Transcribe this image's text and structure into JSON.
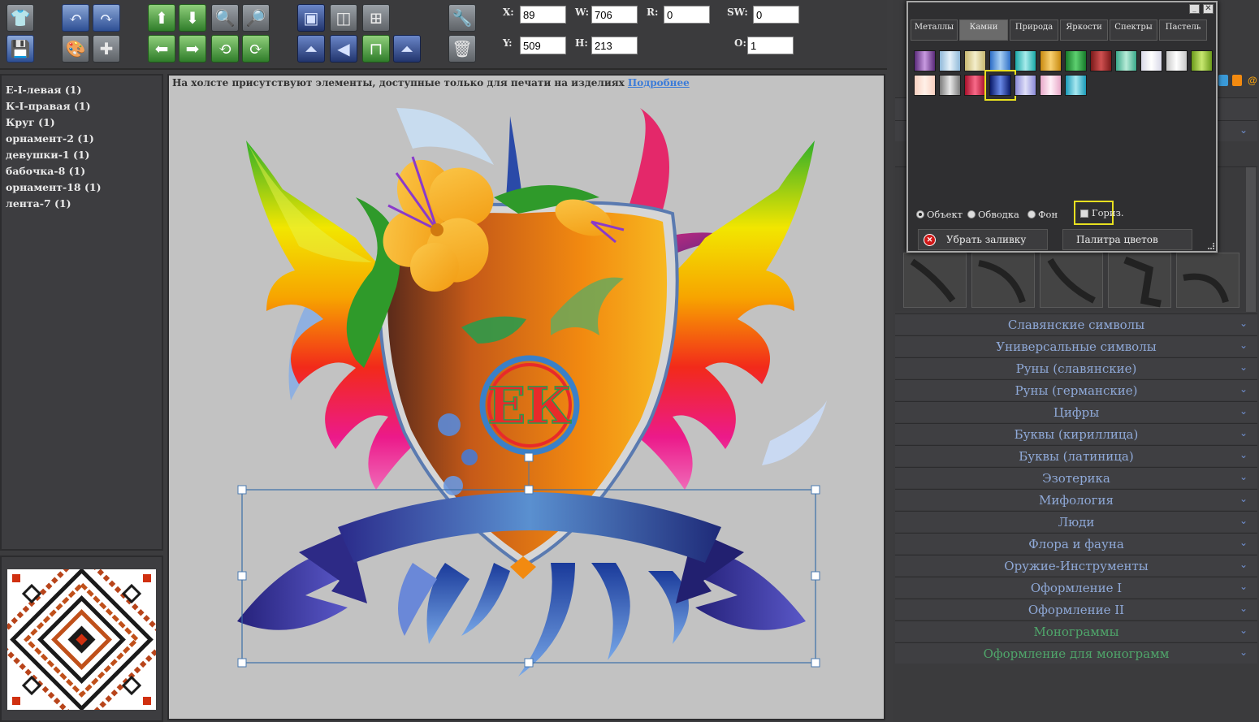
{
  "toolbar": {
    "buttons": [
      {
        "name": "tshirt-icon",
        "glyph": "👕"
      },
      {
        "name": "save-disk-icon",
        "glyph": "💾"
      },
      {
        "name": "undo-icon",
        "glyph": "↶"
      },
      {
        "name": "redo-icon",
        "glyph": "↷"
      },
      {
        "name": "palette-icon",
        "glyph": "🎨"
      },
      {
        "name": "add-element-icon",
        "glyph": "✚"
      },
      {
        "name": "move-up-icon",
        "glyph": "⬆"
      },
      {
        "name": "move-down-icon",
        "glyph": "⬇"
      },
      {
        "name": "move-left-icon",
        "glyph": "⬅"
      },
      {
        "name": "move-right-icon",
        "glyph": "➡"
      },
      {
        "name": "zoom-in-icon",
        "glyph": "🔍"
      },
      {
        "name": "zoom-out-icon",
        "glyph": "🔎"
      },
      {
        "name": "rotate-left-icon",
        "glyph": "⟲"
      },
      {
        "name": "rotate-right-icon",
        "glyph": "⟳"
      },
      {
        "name": "bring-forward-icon",
        "glyph": "▣"
      },
      {
        "name": "send-backward-icon",
        "glyph": "◫"
      },
      {
        "name": "align-center-icon",
        "glyph": "⊞"
      },
      {
        "name": "flip-vertical-icon",
        "glyph": "⏶"
      },
      {
        "name": "flip-horizontal-icon",
        "glyph": "◀"
      },
      {
        "name": "distort-icon",
        "glyph": "⊓"
      },
      {
        "name": "skew-icon",
        "glyph": "⏶"
      },
      {
        "name": "tools-icon",
        "glyph": "🔧"
      },
      {
        "name": "trash-icon",
        "glyph": "🗑"
      }
    ],
    "fields": {
      "x": {
        "label": "X:",
        "value": "89"
      },
      "y": {
        "label": "Y:",
        "value": "509"
      },
      "w": {
        "label": "W:",
        "value": "706"
      },
      "h": {
        "label": "H:",
        "value": "213"
      },
      "r": {
        "label": "R:",
        "value": "0"
      },
      "sw": {
        "label": "SW:",
        "value": "0"
      },
      "o": {
        "label": "O:",
        "value": "1"
      }
    }
  },
  "layers": [
    "Е-I-левая (1)",
    "К-I-правая (1)",
    "Круг (1)",
    "орнамент-2 (1)",
    "девушки-1 (1)",
    "бабочка-8 (1)",
    "орнамент-18 (1)",
    "лента-7 (1)"
  ],
  "canvas": {
    "notice": "На холсте присутствуют элементы, доступные только для печати на изделиях",
    "notice_link": "Подробнее",
    "monogram": "ЕК"
  },
  "palette": {
    "tabs": [
      "Металлы",
      "Камни",
      "Природа",
      "Яркости",
      "Спектры",
      "Пастель"
    ],
    "active_tab": "Камни",
    "swatches": [
      [
        "#5a2a7a",
        "#c89ae0"
      ],
      [
        "#8fb8d8",
        "#e6f2fa"
      ],
      [
        "#c8b870",
        "#f4eecc"
      ],
      [
        "#2e6fc8",
        "#a8d0f4"
      ],
      [
        "#1aa8a8",
        "#a8ecec"
      ],
      [
        "#c88a10",
        "#f8d070"
      ],
      [
        "#167a2a",
        "#5ed070"
      ],
      [
        "#7a1a1a",
        "#d05050"
      ],
      [
        "#3aa88a",
        "#b8ecd8"
      ],
      [
        "#d8d8e8",
        "#ffffff"
      ],
      [
        "#c8c8c8",
        "#ffffff"
      ],
      [
        "#6a9a1a",
        "#c8e870"
      ],
      [
        "#f8d0c0",
        "#fff0e8"
      ],
      [
        "#7a7a7a",
        "#e8e8e8"
      ],
      [
        "#a8102a",
        "#f86a8a"
      ],
      [
        "#0a1a6a",
        "#6a8ae8"
      ],
      [
        "#8a8ad8",
        "#e0e0f8"
      ],
      [
        "#e8a8c8",
        "#fff0f8"
      ],
      [
        "#1a9ab8",
        "#a8e8f0"
      ]
    ],
    "selected_swatch": 15,
    "radios": [
      {
        "label": "Объект",
        "checked": true
      },
      {
        "label": "Обводка",
        "checked": false
      },
      {
        "label": "Фон",
        "checked": false
      }
    ],
    "horiz_label": "Гориз.",
    "remove_fill": "Убрать заливку",
    "color_palette": "Палитра цветов"
  },
  "categories": [
    {
      "label": "Славянские символы",
      "mono": false
    },
    {
      "label": "Универсальные символы",
      "mono": false
    },
    {
      "label": "Руны (славянские)",
      "mono": false
    },
    {
      "label": "Руны (германские)",
      "mono": false
    },
    {
      "label": "Цифры",
      "mono": false
    },
    {
      "label": "Буквы (кириллица)",
      "mono": false
    },
    {
      "label": "Буквы (латиница)",
      "mono": false
    },
    {
      "label": "Эзотерика",
      "mono": false
    },
    {
      "label": "Мифология",
      "mono": false
    },
    {
      "label": "Люди",
      "mono": false
    },
    {
      "label": "Флора и фауна",
      "mono": false
    },
    {
      "label": "Оружие-Инструменты",
      "mono": false
    },
    {
      "label": "Оформление I",
      "mono": false
    },
    {
      "label": "Оформление II",
      "mono": false
    },
    {
      "label": "Монограммы",
      "mono": true
    },
    {
      "label": "Оформление для монограмм",
      "mono": true
    }
  ]
}
